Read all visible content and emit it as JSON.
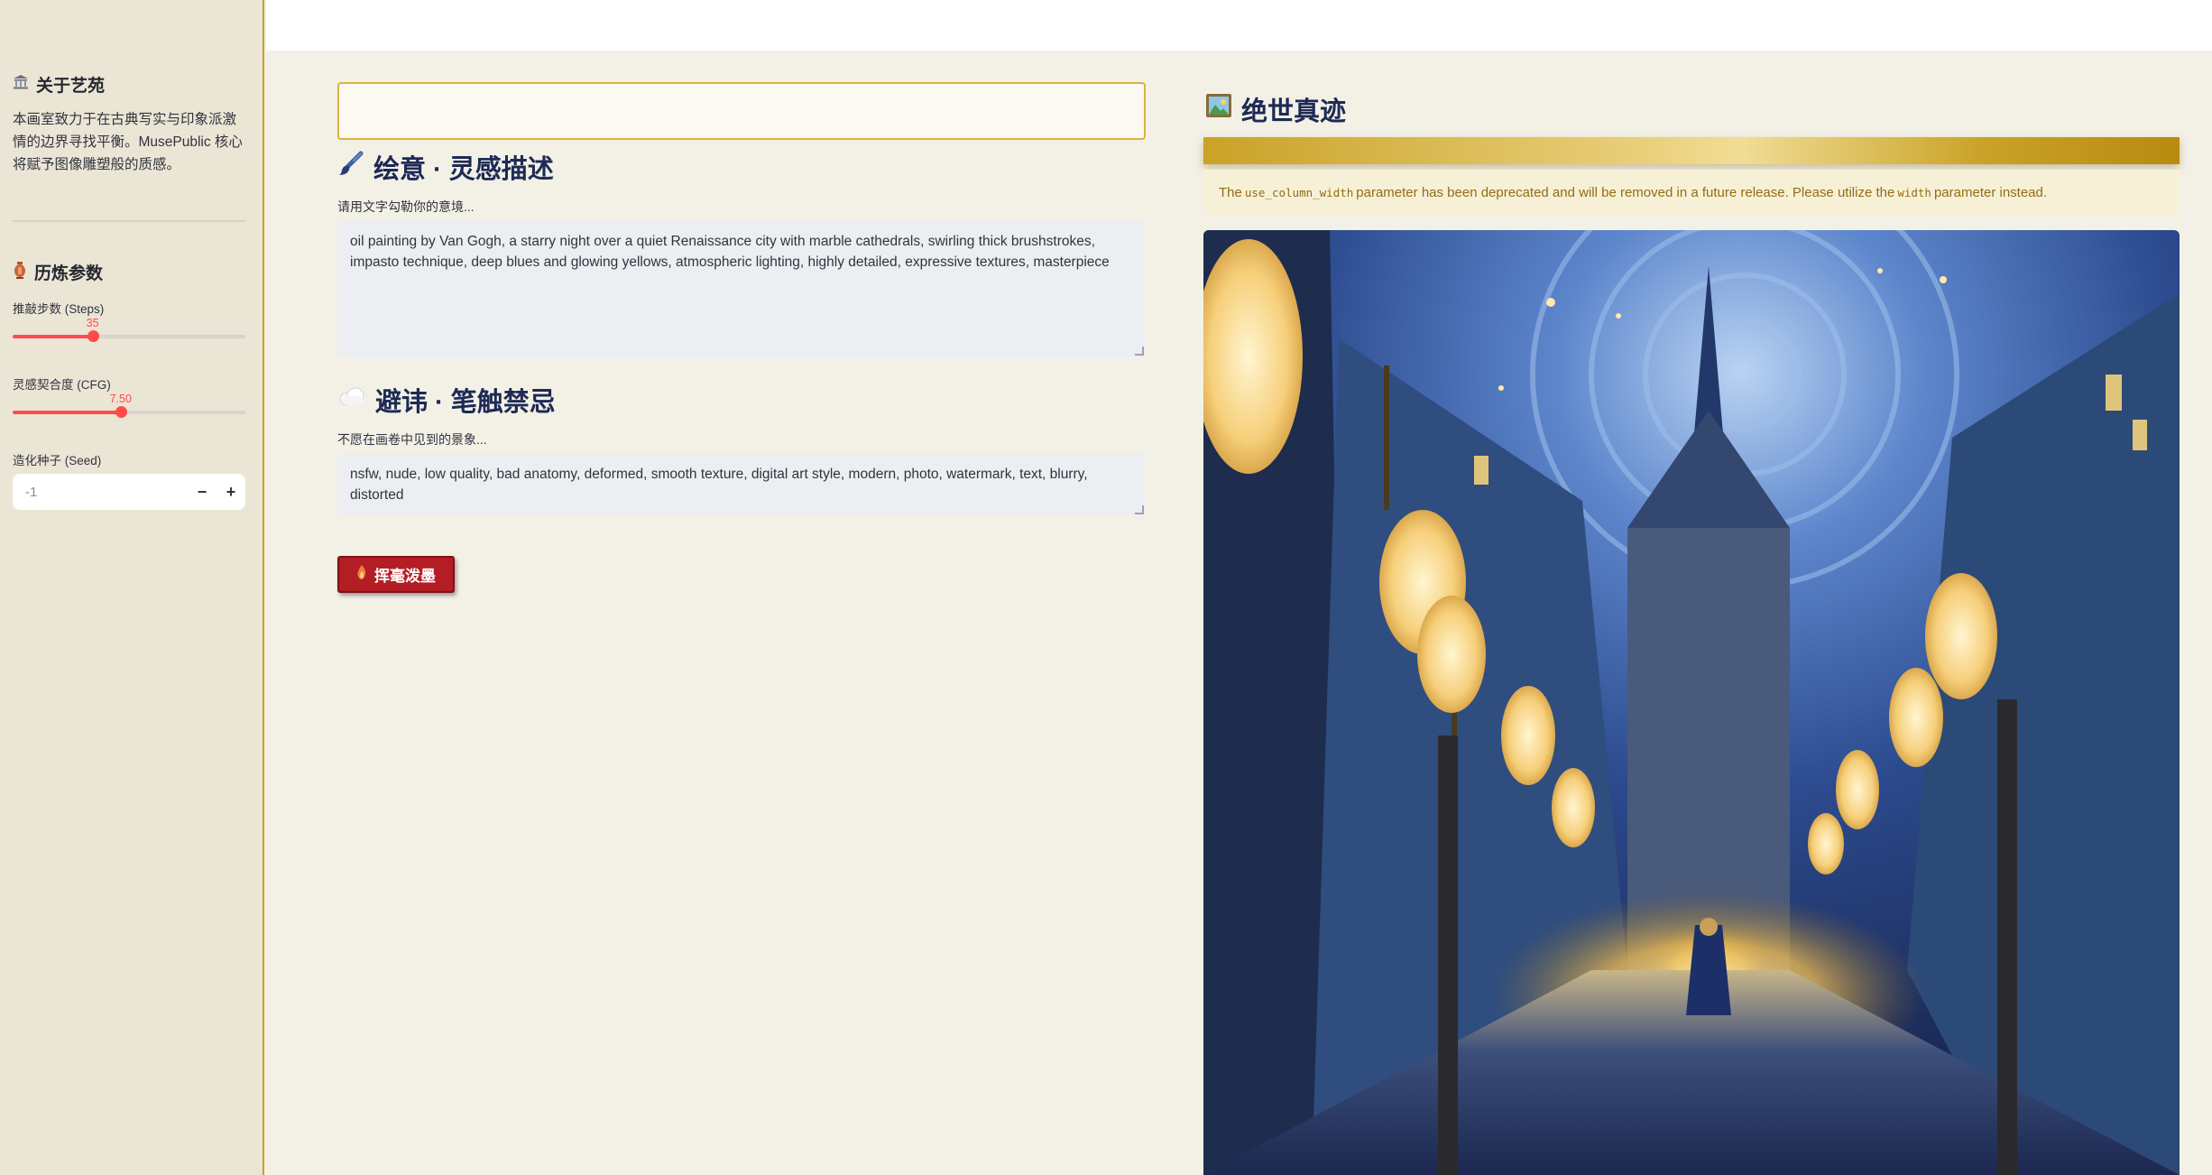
{
  "sidebar": {
    "about": {
      "title": "关于艺苑",
      "icon": "classical-building-icon",
      "text": "本画室致力于在古典写实与印象派激情的边界寻找平衡。MusePublic 核心将赋予图像雕塑般的质感。"
    },
    "params": {
      "title": "历炼参数",
      "icon": "amphora-icon",
      "steps": {
        "label": "推敲步数 (Steps)",
        "value": 35,
        "display": "35",
        "min": 1,
        "max": 100
      },
      "cfg": {
        "label": "灵感契合度 (CFG)",
        "value": 7.5,
        "display": "7.50",
        "min": 1.0,
        "max": 15.0
      },
      "seed": {
        "label": "造化种子 (Seed)",
        "value": "-1",
        "minus": "−",
        "plus": "+"
      }
    }
  },
  "main": {
    "title_input": {
      "value": ""
    },
    "prompt": {
      "heading": "绘意 · 灵感描述",
      "icon": "paintbrush-icon",
      "label": "请用文字勾勒你的意境...",
      "value": "oil painting by Van Gogh, a starry night over a quiet Renaissance city with marble cathedrals, swirling thick brushstrokes, impasto technique, deep blues and glowing yellows, atmospheric lighting, highly detailed, expressive textures, masterpiece"
    },
    "negative": {
      "heading": "避讳 · 笔触禁忌",
      "icon": "cloud-icon",
      "label": "不愿在画卷中见到的景象...",
      "value": "nsfw, nude, low quality, bad anatomy, deformed, smooth texture, digital art style, modern, photo, watermark, text, blurry, distorted"
    },
    "generate_button": {
      "label": "挥毫泼墨",
      "icon": "flame-icon"
    }
  },
  "result": {
    "heading": "绝世真迹",
    "icon": "framed-picture-icon",
    "warning": {
      "prefix": "The",
      "code1": "use_column_width",
      "middle": "parameter has been deprecated and will be removed in a future release. Please utilize the",
      "code2": "width",
      "suffix": "parameter instead."
    }
  },
  "colors": {
    "accent_red": "#ff4b4b",
    "gold": "#c9a227",
    "heading_navy": "#1e2a55",
    "button_red": "#b31d24"
  }
}
